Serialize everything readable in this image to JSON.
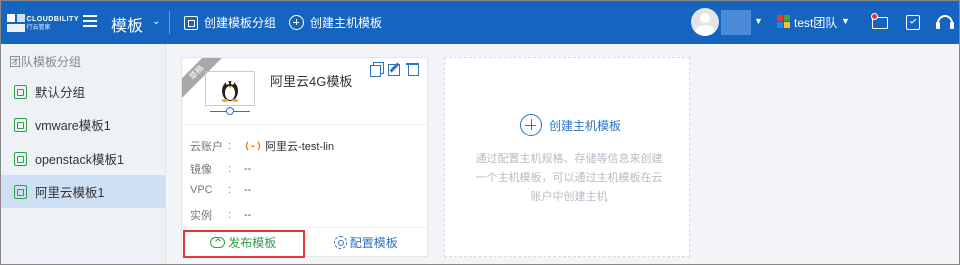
{
  "brand": {
    "name": "CLOUDBILITY",
    "sub": "行云管家"
  },
  "header": {
    "module_title": "模板",
    "actions": [
      {
        "label": "创建模板分组",
        "icon": "template-group-icon"
      },
      {
        "label": "创建主机模板",
        "icon": "add-circle-icon"
      }
    ],
    "user_name": "",
    "team_name": "test团队"
  },
  "sidebar": {
    "header": "团队模板分组",
    "items": [
      {
        "label": "默认分组"
      },
      {
        "label": "vmware模板1"
      },
      {
        "label": "openstack模板1"
      },
      {
        "label": "阿里云模板1",
        "active": true
      }
    ]
  },
  "card": {
    "ribbon": "草稿",
    "title": "阿里云4G模板",
    "os_icon": "linux-penguin-icon",
    "fields": [
      {
        "key": "云账户",
        "value": "阿里云-test-lin",
        "badge": "(-)"
      },
      {
        "key": "镜像",
        "value": "--"
      },
      {
        "key": "VPC",
        "value": "--"
      },
      {
        "key": "实例",
        "value": "--"
      }
    ],
    "colon": ":",
    "publish_label": "发布模板",
    "configure_label": "配置模板"
  },
  "create_card": {
    "title": "创建主机模板",
    "description": "通过配置主机规格、存储等信息来创建一个主机模板，可以通过主机模板在云账户中创建主机"
  },
  "colors": {
    "topbar": "#1565c0",
    "accent": "#2d72c4",
    "publish": "#2e9e4b",
    "highlight": "#e53935"
  }
}
